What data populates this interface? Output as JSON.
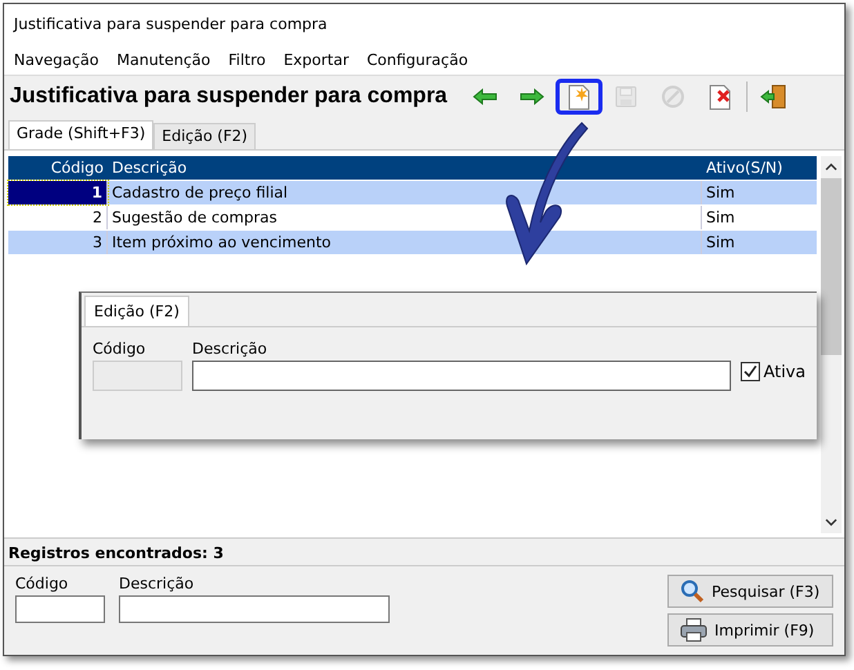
{
  "window": {
    "title": "Justificativa para suspender para compra"
  },
  "menu": [
    "Navegação",
    "Manutenção",
    "Filtro",
    "Exportar",
    "Configuração"
  ],
  "toolbar": {
    "title": "Justificativa para suspender para compra",
    "buttons": [
      {
        "kind": "back",
        "disabled": false,
        "highlighted": false
      },
      {
        "kind": "forward",
        "disabled": false,
        "highlighted": false
      },
      {
        "kind": "new",
        "disabled": false,
        "highlighted": true
      },
      {
        "kind": "save",
        "disabled": true,
        "highlighted": false
      },
      {
        "kind": "cancel",
        "disabled": true,
        "highlighted": false
      },
      {
        "kind": "delete",
        "disabled": false,
        "highlighted": false
      },
      {
        "kind": "exit",
        "disabled": false,
        "highlighted": false
      }
    ]
  },
  "tabs": [
    {
      "label": "Grade (Shift+F3)",
      "selected": true
    },
    {
      "label": "Edição (F2)",
      "selected": false
    }
  ],
  "table": {
    "columns": [
      "Código",
      "Descrição",
      "Ativo(S/N)"
    ],
    "rows": [
      {
        "cells": [
          "1",
          "Cadastro de preço filial",
          "Sim"
        ],
        "highlighted": true,
        "focused": true
      },
      {
        "cells": [
          "2",
          "Sugestão de compras",
          "Sim"
        ],
        "highlighted": false,
        "focused": false
      },
      {
        "cells": [
          "3",
          "Item próximo ao vencimento",
          "Sim"
        ],
        "highlighted": true,
        "focused": false
      }
    ]
  },
  "inset": {
    "tab": "Edição (F2)",
    "code_label": "Código",
    "description_label": "Descrição",
    "checkbox": {
      "label": "Ativa",
      "checked": true
    }
  },
  "status": "Registros encontrados: 3",
  "filter": {
    "code_label": "Código",
    "description_label": "Descrição",
    "buttons": [
      {
        "kind": "search",
        "label": "Pesquisar (F3)"
      },
      {
        "kind": "print",
        "label": "Imprimir (F9)"
      }
    ]
  }
}
